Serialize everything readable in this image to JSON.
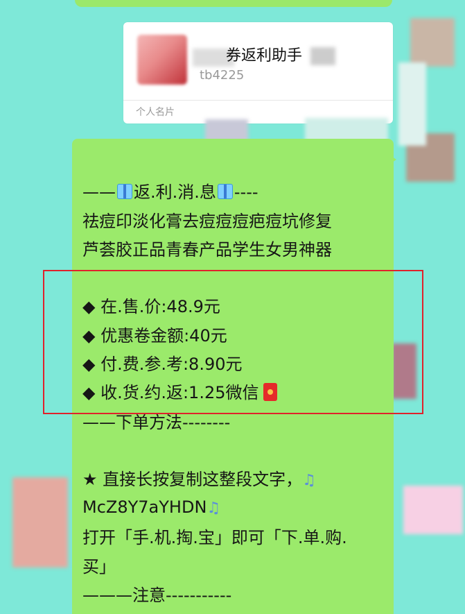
{
  "contact_card": {
    "name": "券返利助手",
    "account": "tb4225",
    "type_label": "个人名片"
  },
  "message": {
    "lines": [
      "——",
      "返.利.消.息",
      "----",
      "祛痘印淡化膏去痘痘痘疤痘坑修复",
      "芦荟胶正品青春产品学生女男神器",
      "◆ 在.售.价:48.9元",
      "◆ 优惠卷金额:40元",
      "◆ 付.费.参.考:8.90元",
      "◆ 收.货.约.返:1.25微信",
      "——下单方法--------",
      "★ 直接长按复制这整段文字，",
      "McZ8Y7aYHDN",
      "打开「手.机.掏.宝」即可「下.单.购.",
      "买」",
      "———注意-----------"
    ],
    "note_icon": "♫"
  },
  "colors": {
    "background": "#7ee8d8",
    "bubble": "#9bea6b",
    "highlight": "#e0212b"
  },
  "icons": [
    "gift-icon",
    "red-envelope-icon",
    "music-note-icon"
  ]
}
